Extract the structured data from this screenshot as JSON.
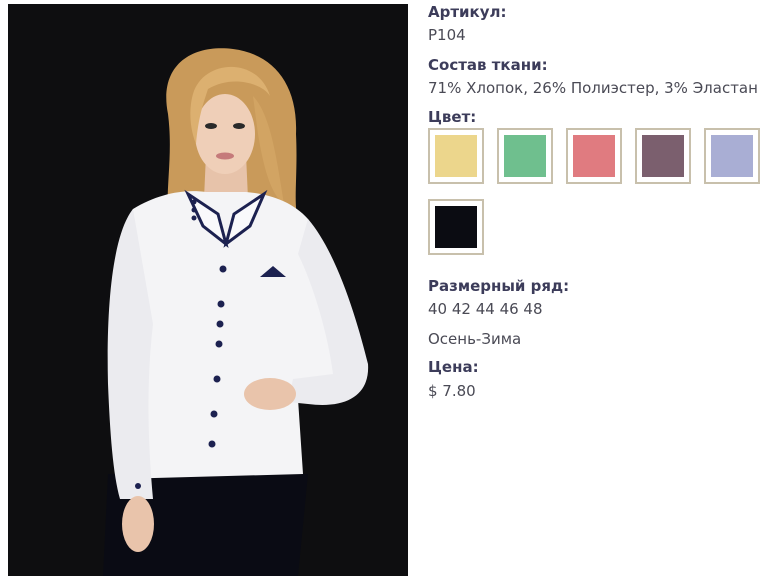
{
  "product": {
    "article_label": "Артикул:",
    "article_value": "P104",
    "fabric_label": "Состав ткани:",
    "fabric_value": "71% Хлопок, 26% Полиэстер, 3% Эластан",
    "color_label": "Цвет:",
    "colors": [
      {
        "name": "yellow",
        "hex": "#ecd68c"
      },
      {
        "name": "mint",
        "hex": "#6fbf8e"
      },
      {
        "name": "pink",
        "hex": "#e07b80"
      },
      {
        "name": "plum",
        "hex": "#7b5f6e"
      },
      {
        "name": "lavender",
        "hex": "#a9aed4"
      },
      {
        "name": "black",
        "hex": "#0b0c12"
      }
    ],
    "sizes_label": "Размерный ряд:",
    "sizes_value": "40 42 44 46 48",
    "season_value": "Осень-Зима",
    "price_label": "Цена:",
    "price_value": "$ 7.80"
  },
  "photo": {
    "subject": "woman-in-white-shirt-with-navy-trim",
    "background_color": "#0e0e10",
    "shirt_color": "#f4f4f6",
    "trim_color": "#1c2150",
    "hair_color": "#d6a968"
  }
}
